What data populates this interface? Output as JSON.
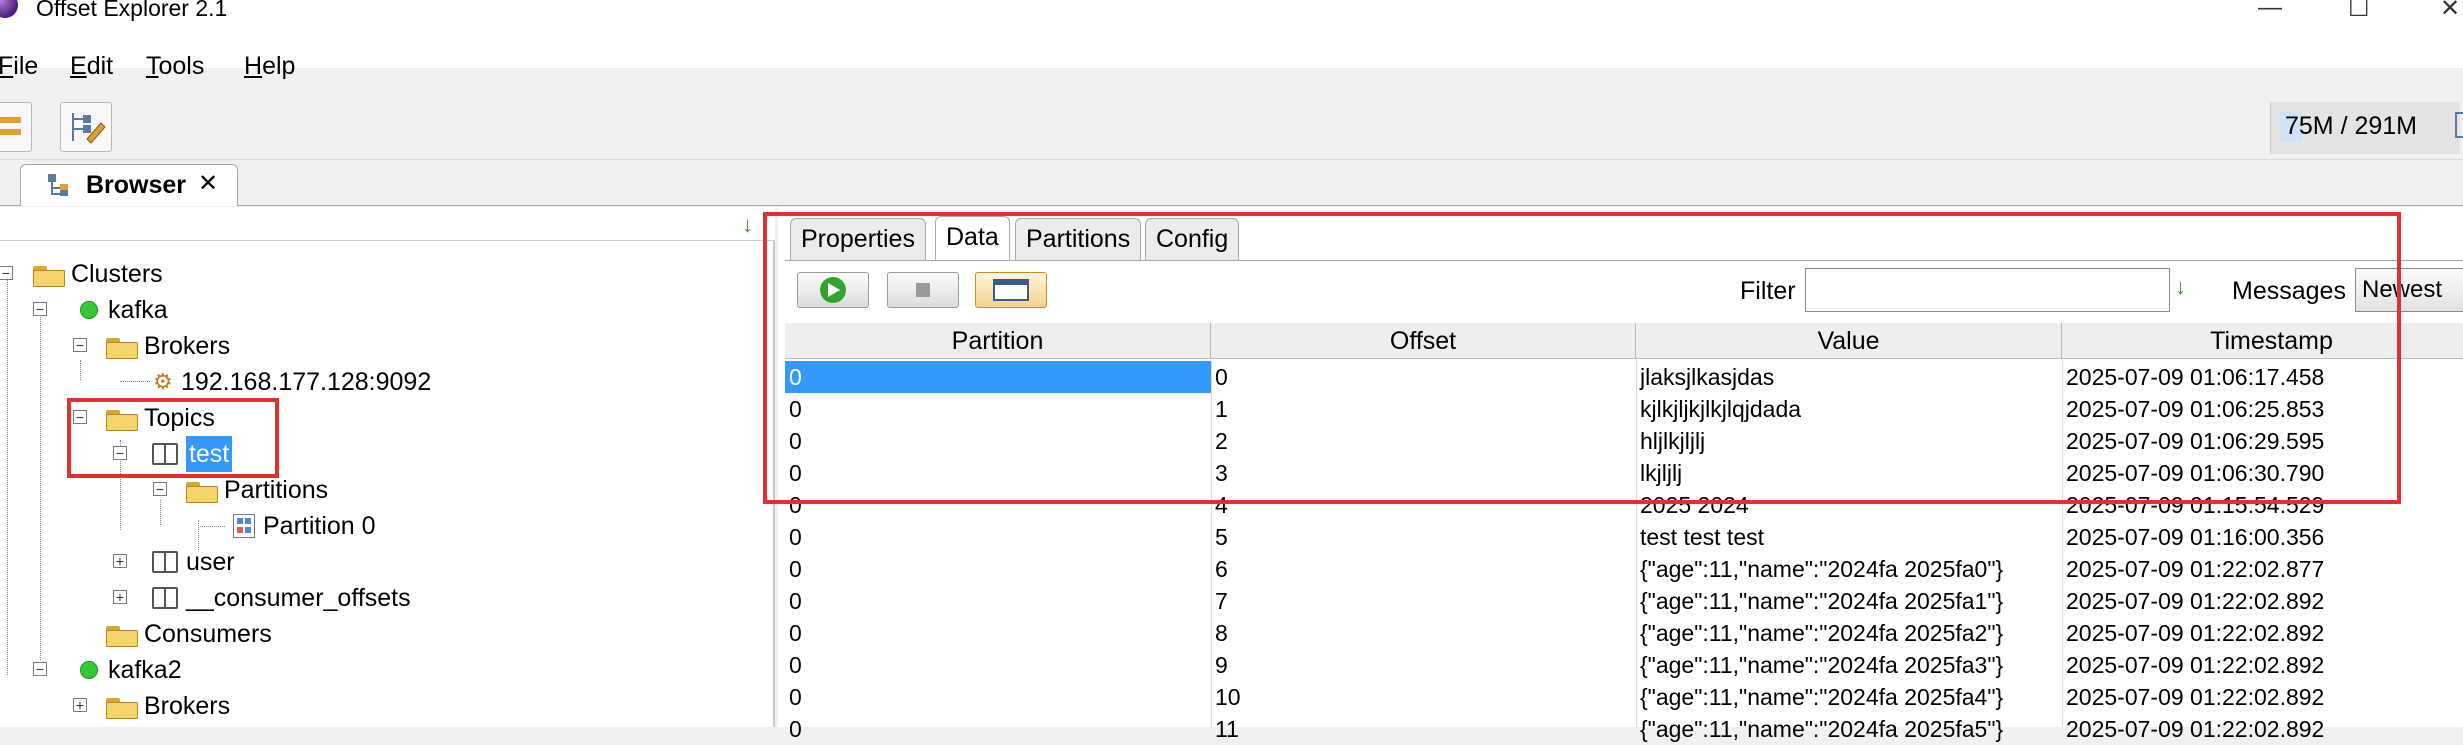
{
  "window": {
    "title": "Offset Explorer  2.1",
    "minimize_glyph": "—",
    "maximize_glyph": "☐",
    "close_glyph": "✕"
  },
  "menu": [
    {
      "key": "F",
      "rest": "ile"
    },
    {
      "key": "E",
      "rest": "dit"
    },
    {
      "key": "T",
      "rest": "ools"
    },
    {
      "key": "H",
      "rest": "elp"
    }
  ],
  "toolbar": {
    "memory": "75M / 291M",
    "icons": [
      "connect-icon",
      "edit-properties-icon",
      "trash-icon"
    ]
  },
  "browser_tab": {
    "label": "Browser",
    "close_glyph": "✕",
    "icon": "browser-tree-icon"
  },
  "tree": {
    "clusters": "Clusters",
    "kafka": "kafka",
    "brokers": "Brokers",
    "broker_addr": "192.168.177.128:9092",
    "topics": "Topics",
    "test": "test",
    "partitions": "Partitions",
    "partition0": "Partition 0",
    "user": "user",
    "consumer_offsets": "__consumer_offsets",
    "consumers": "Consumers",
    "kafka2": "kafka2",
    "brokers2": "Brokers"
  },
  "tabs": {
    "properties": "Properties",
    "data": "Data",
    "partitions": "Partitions",
    "config": "Config"
  },
  "data_controls": {
    "filter_label": "Filter",
    "filter_value": "",
    "messages_label": "Messages",
    "messages_value": "Newest"
  },
  "table": {
    "headers": {
      "partition": "Partition",
      "offset": "Offset",
      "value": "Value",
      "timestamp": "Timestamp"
    },
    "rows": [
      {
        "partition": "0",
        "offset": "0",
        "value": "jlaksjlkasjdas",
        "timestamp": "2025-07-09 01:06:17.458"
      },
      {
        "partition": "0",
        "offset": "1",
        "value": "kjlkjljkjlkjlqjdada",
        "timestamp": "2025-07-09 01:06:25.853"
      },
      {
        "partition": "0",
        "offset": "2",
        "value": "hljlkjljlj",
        "timestamp": "2025-07-09 01:06:29.595"
      },
      {
        "partition": "0",
        "offset": "3",
        "value": "lkjljlj",
        "timestamp": "2025-07-09 01:06:30.790"
      },
      {
        "partition": "0",
        "offset": "4",
        "value": "2025 2024",
        "timestamp": "2025-07-09 01:15:54.529"
      },
      {
        "partition": "0",
        "offset": "5",
        "value": "test test test",
        "timestamp": "2025-07-09 01:16:00.356"
      },
      {
        "partition": "0",
        "offset": "6",
        "value": "{\"age\":11,\"name\":\"2024fa  2025fa0\"}",
        "timestamp": "2025-07-09 01:22:02.877"
      },
      {
        "partition": "0",
        "offset": "7",
        "value": "{\"age\":11,\"name\":\"2024fa  2025fa1\"}",
        "timestamp": "2025-07-09 01:22:02.892"
      },
      {
        "partition": "0",
        "offset": "8",
        "value": "{\"age\":11,\"name\":\"2024fa  2025fa2\"}",
        "timestamp": "2025-07-09 01:22:02.892"
      },
      {
        "partition": "0",
        "offset": "9",
        "value": "{\"age\":11,\"name\":\"2024fa  2025fa3\"}",
        "timestamp": "2025-07-09 01:22:02.892"
      },
      {
        "partition": "0",
        "offset": "10",
        "value": "{\"age\":11,\"name\":\"2024fa  2025fa4\"}",
        "timestamp": "2025-07-09 01:22:02.892"
      },
      {
        "partition": "0",
        "offset": "11",
        "value": "{\"age\":11,\"name\":\"2024fa  2025fa5\"}",
        "timestamp": "2025-07-09 01:22:02.892"
      }
    ]
  },
  "colors": {
    "selection": "#3399ff",
    "annotation_red": "#e03030",
    "status_green": "#34c934"
  }
}
